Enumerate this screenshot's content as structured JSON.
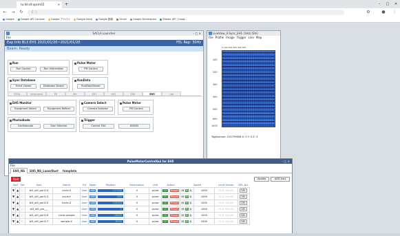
{
  "browser": {
    "tab_title": "tu:lkl:xlt:xpcmG5",
    "address": "C  ⓘ",
    "bookmarks": [
      "Google",
      "Google API Console",
      "Google アドバイ",
      "Google Keep",
      "Google 検索",
      "Gmail",
      "Google Developers",
      "Sheets API | Goog..."
    ]
  },
  "launcher": {
    "title": "SACLA Launcher",
    "menu": "File",
    "exp_info": "Exp Info BL3 EH1 2021/01/20~2021/01/20",
    "fel_rep": "FEL Rep: 30Hz",
    "beam": "Beam: Ready",
    "groups": {
      "run": {
        "title": "Run",
        "buttons": [
          "Run Control",
          "Run Information"
        ]
      },
      "pulse_motor": {
        "title": "Pulse Motor",
        "buttons": [
          "PM Control"
        ]
      },
      "sync_db": {
        "title": "Sync Database",
        "buttons": [
          "Trend Viewer",
          "Database Viewer"
        ]
      },
      "run_data": {
        "title": "RunData",
        "buttons": [
          "RunDataViewer"
        ]
      }
    },
    "tabs": [
      "EH1A",
      "Instrument",
      "PX",
      "MX",
      "EH1",
      "EH2",
      "EH4",
      "EH5",
      "Lab"
    ],
    "selected_tab": "EH5",
    "eh5": {
      "monitor": {
        "title": "EH5 Monitor",
        "buttons": [
          "Equipment Select",
          "Equipment Reflect"
        ]
      },
      "camera": {
        "title": "Camera Select",
        "buttons": [
          "Camera Selector"
        ]
      },
      "pulse": {
        "title": "Pulse Motor",
        "buttons": [
          "PM Control"
        ]
      },
      "photodiode": {
        "title": "Photodiode",
        "buttons": [
          "Oscilloscope",
          "Gain Selector"
        ]
      },
      "trigger": {
        "title": "Trigger",
        "buttons": [
          "Control TAU",
          "DG645"
        ]
      }
    }
  },
  "liveview": {
    "title": "LiveView_II-Sync_EH1 (1Hz) (Shi)",
    "menu": [
      "File",
      "Profile",
      "Image",
      "Trigger",
      "Line",
      "Map"
    ],
    "xticks": "0  100 200 300 400 500",
    "yticks": [
      "100",
      "200",
      "300",
      "400",
      "500",
      "600",
      "1000"
    ],
    "tag": "TagNumber: 224799608   X: 0  Y: 0  Z: 3"
  },
  "pmc": {
    "title": "PulseMotorControlGui for EH5",
    "menu": "File",
    "tabs": [
      "EH5_NS",
      "EH5_NS_LaserDuct",
      "template"
    ],
    "quit": "Quit",
    "update": "Update",
    "add_axis": "ADD Axis",
    "headers": [
      "Sort",
      "Set",
      "Axis",
      "Name",
      "F/U",
      "Mode",
      "Position",
      "Destination",
      "Unit",
      "Action",
      "Speed",
      "Limit Sensor",
      "DEL ALL"
    ],
    "rows": [
      {
        "axis": "bl3_st5_pm114",
        "name": "circle-X",
        "fu": "User",
        "mode": "ABS",
        "position": "127520",
        "dest": "0",
        "unit": "pulse",
        "speed": "1000",
        "limit": "H -0 +0 >H"
      },
      {
        "axis": "bl3_st5_pm113",
        "name": "circle-Y",
        "fu": "User",
        "mode": "ABS",
        "position": "820",
        "dest": "0",
        "unit": "pulse",
        "speed": "1000",
        "limit": "H -0 +0 >H"
      },
      {
        "axis": "bl3_st5_pm115",
        "name": "circle-Z",
        "fu": "User",
        "mode": "ABS",
        "position": "149016",
        "dest": "0",
        "unit": "pulse",
        "speed": "1000",
        "limit": "H -0 +0 >H"
      },
      {
        "axis": "bl3_st5_pm___",
        "name": "",
        "fu": "User",
        "mode": "ABS",
        "position": "0",
        "dest": "0",
        "unit": "pulse",
        "speed": "1000",
        "limit": "H -0 +0 >H"
      },
      {
        "axis": "bl3_st5_pm116",
        "name": "circle-sample",
        "fu": "User",
        "mode": "ABS",
        "position": "16492",
        "dest": "0",
        "unit": "pulse",
        "speed": "1000",
        "limit": "H -0 +0 >H"
      },
      {
        "axis": "bl3_st5_pm117",
        "name": "sample-X",
        "fu": "User",
        "mode": "ABS",
        "position": "-8920",
        "dest": "0",
        "unit": "pulse",
        "speed": "2500",
        "limit": "H -0 +0 >H"
      }
    ],
    "go": "GO",
    "preset": "Preset",
    "del": "DEL",
    "hml": [
      "H",
      "M",
      "L"
    ]
  }
}
